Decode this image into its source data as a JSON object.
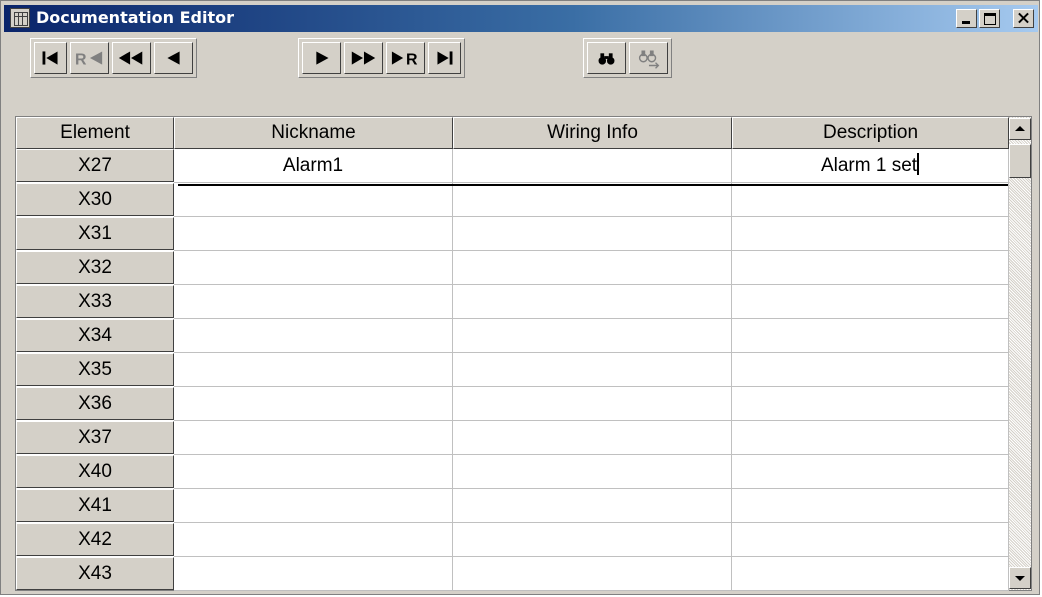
{
  "window": {
    "title": "Documentation Editor"
  },
  "toolbar": {
    "nav_buttons": [
      "first-record",
      "previous-referenced",
      "previous-page",
      "previous-record",
      "next-record",
      "next-page",
      "next-referenced",
      "last-record"
    ],
    "search_buttons": [
      "find",
      "find-next"
    ]
  },
  "grid": {
    "columns": [
      "Element",
      "Nickname",
      "Wiring Info",
      "Description"
    ],
    "rows": [
      {
        "element": "X27",
        "nickname": "Alarm1",
        "wiring": "",
        "description": "Alarm 1 set"
      },
      {
        "element": "X30",
        "nickname": "",
        "wiring": "",
        "description": ""
      },
      {
        "element": "X31",
        "nickname": "",
        "wiring": "",
        "description": ""
      },
      {
        "element": "X32",
        "nickname": "",
        "wiring": "",
        "description": ""
      },
      {
        "element": "X33",
        "nickname": "",
        "wiring": "",
        "description": ""
      },
      {
        "element": "X34",
        "nickname": "",
        "wiring": "",
        "description": ""
      },
      {
        "element": "X35",
        "nickname": "",
        "wiring": "",
        "description": ""
      },
      {
        "element": "X36",
        "nickname": "",
        "wiring": "",
        "description": ""
      },
      {
        "element": "X37",
        "nickname": "",
        "wiring": "",
        "description": ""
      },
      {
        "element": "X40",
        "nickname": "",
        "wiring": "",
        "description": ""
      },
      {
        "element": "X41",
        "nickname": "",
        "wiring": "",
        "description": ""
      },
      {
        "element": "X42",
        "nickname": "",
        "wiring": "",
        "description": ""
      },
      {
        "element": "X43",
        "nickname": "",
        "wiring": "",
        "description": ""
      }
    ]
  },
  "colors": {
    "titlebar_start": "#0a246a",
    "titlebar_end": "#a6caf0",
    "face": "#d4d0c8",
    "disabled": "#808080"
  }
}
